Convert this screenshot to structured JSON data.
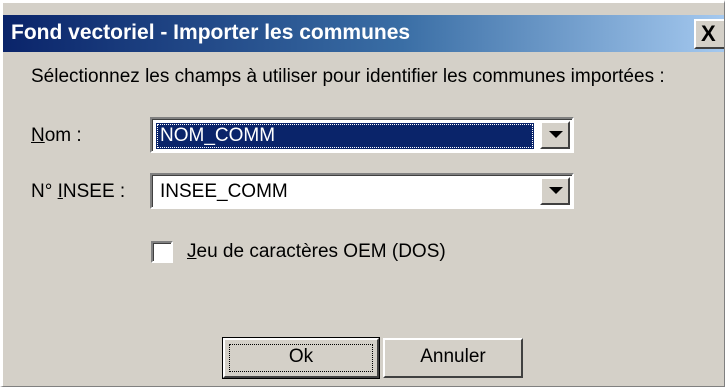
{
  "dialog": {
    "title": "Fond vectoriel - Importer les communes",
    "close_label": "X",
    "instruction": "Sélectionnez les champs à utiliser pour identifier les communes importées :",
    "fields": {
      "nom": {
        "label_mnemonic": "N",
        "label_rest": "om :",
        "value": "NOM_COMM"
      },
      "insee": {
        "label_prefix": "N° ",
        "label_mnemonic": "I",
        "label_rest": "NSEE :",
        "value": "INSEE_COMM"
      }
    },
    "checkbox": {
      "label_mnemonic": "J",
      "label_rest": "eu de caractères OEM (DOS)",
      "checked": false
    },
    "buttons": {
      "ok_label": "Ok",
      "cancel_label": "Annuler"
    }
  }
}
